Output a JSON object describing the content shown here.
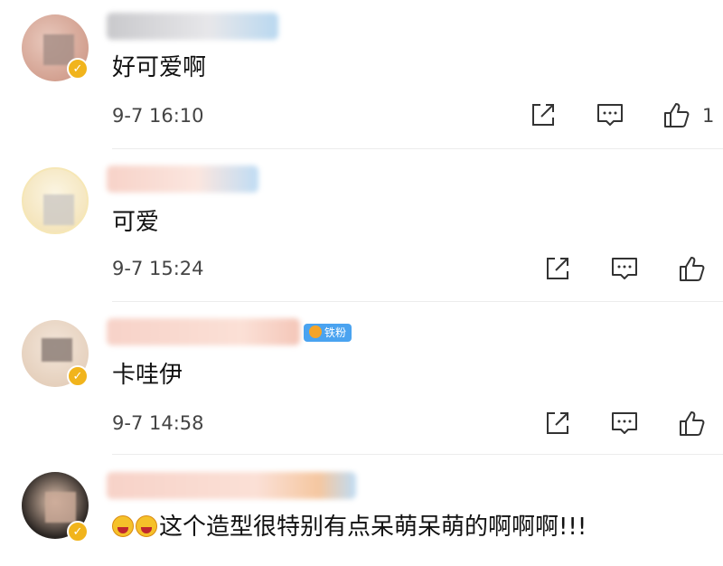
{
  "comments": [
    {
      "text": "好可爱啊",
      "time": "9-7 16:10",
      "like_count": "1"
    },
    {
      "text": "可爱",
      "time": "9-7 15:24"
    },
    {
      "text": "卡哇伊",
      "time": "9-7 14:58",
      "vip_label": "铁粉"
    },
    {
      "text": "这个造型很特别有点呆萌呆萌的啊啊啊!!!",
      "emoji": "laughing-crying-emoji"
    }
  ],
  "colors": {
    "icon": "#333333",
    "badge": "#f1b41c",
    "vip": "#4aa3f0"
  }
}
